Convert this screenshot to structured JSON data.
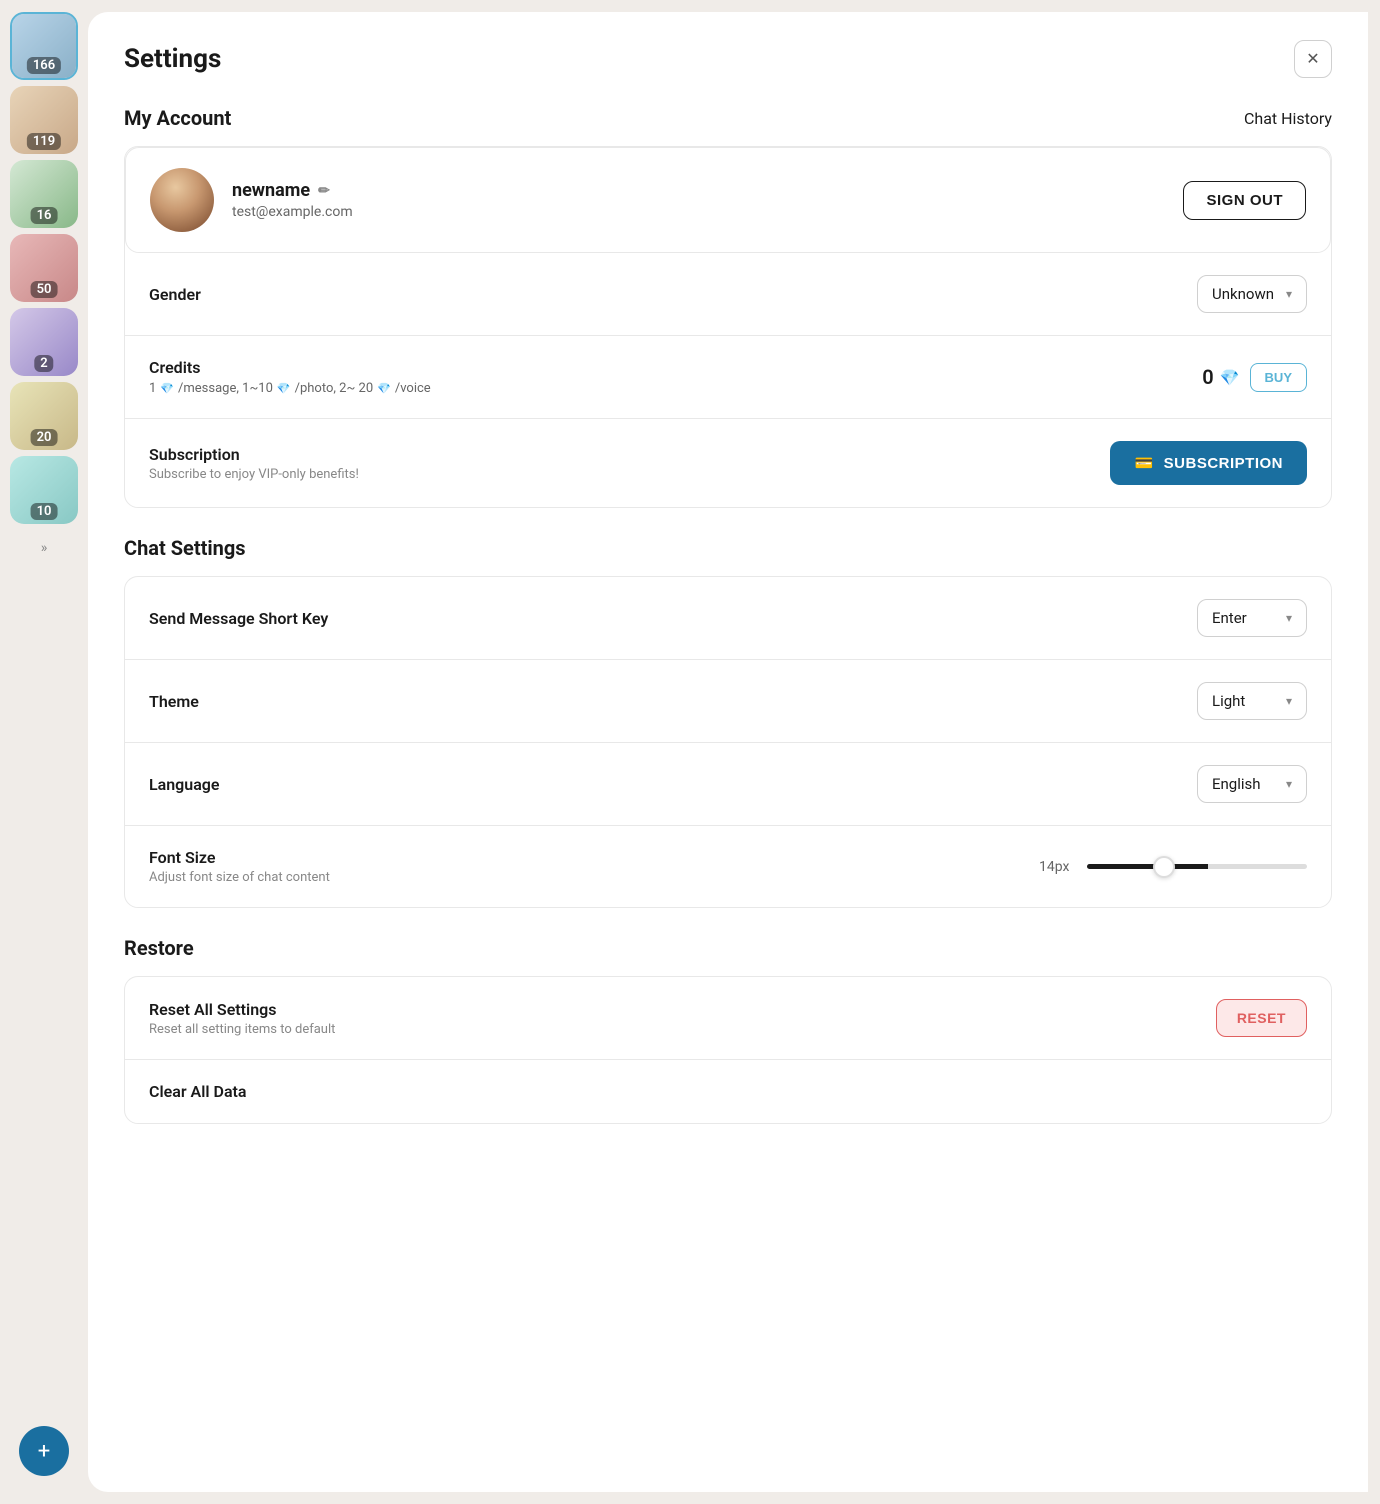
{
  "sidebar": {
    "items": [
      {
        "id": "item-1",
        "badge": "166",
        "active": true,
        "avatar_style": "avatar-1"
      },
      {
        "id": "item-2",
        "badge": "119",
        "active": false,
        "avatar_style": "avatar-2"
      },
      {
        "id": "item-3",
        "badge": "16",
        "active": false,
        "avatar_style": "avatar-3"
      },
      {
        "id": "item-4",
        "badge": "50",
        "active": false,
        "avatar_style": "avatar-4"
      },
      {
        "id": "item-5",
        "badge": "2",
        "active": false,
        "avatar_style": "avatar-5"
      },
      {
        "id": "item-6",
        "badge": "20",
        "active": false,
        "avatar_style": "avatar-6"
      },
      {
        "id": "item-7",
        "badge": "10",
        "active": false,
        "avatar_style": "avatar-7"
      }
    ],
    "expand_icon": "»",
    "add_icon": "+"
  },
  "header": {
    "title": "Settings",
    "close_icon": "✕"
  },
  "my_account": {
    "section_title": "My Account",
    "chat_history_label": "Chat History",
    "username": "newname",
    "email": "test@example.com",
    "sign_out_label": "SIGN OUT",
    "edit_icon": "✏"
  },
  "gender": {
    "label": "Gender",
    "value": "Unknown",
    "chevron": "▾"
  },
  "credits": {
    "label": "Credits",
    "sublabel_parts": [
      "1",
      "/message, 1~10",
      "/photo, 2~ 20",
      "/voice"
    ],
    "value": "0",
    "buy_label": "BUY"
  },
  "subscription": {
    "label": "Subscription",
    "sublabel": "Subscribe to enjoy VIP-only benefits!",
    "button_label": "SUBSCRIPTION",
    "card_icon": "💳"
  },
  "chat_settings": {
    "section_title": "Chat Settings",
    "send_message_shortkey": {
      "label": "Send Message Short Key",
      "value": "Enter",
      "chevron": "▾"
    },
    "theme": {
      "label": "Theme",
      "value": "Light",
      "chevron": "▾"
    },
    "language": {
      "label": "Language",
      "value": "English",
      "chevron": "▾"
    },
    "font_size": {
      "label": "Font Size",
      "sublabel": "Adjust font size of chat content",
      "value": "14px",
      "slider_value": 55
    }
  },
  "restore": {
    "section_title": "Restore",
    "reset_all": {
      "label": "Reset All Settings",
      "sublabel": "Reset all setting items to default",
      "button_label": "RESET"
    },
    "clear_all_data": {
      "label": "Clear All Data"
    }
  }
}
